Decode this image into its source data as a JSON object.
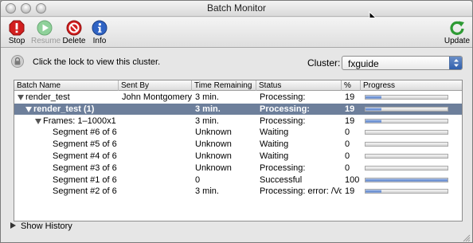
{
  "window": {
    "title": "Batch Monitor"
  },
  "toolbar": {
    "stop_label": "Stop",
    "resume_label": "Resume",
    "delete_label": "Delete",
    "info_label": "Info",
    "update_label": "Update"
  },
  "lock": {
    "text": "Click the lock to view this cluster."
  },
  "cluster": {
    "label": "Cluster:",
    "value": "fxguide"
  },
  "table": {
    "columns": [
      "Batch Name",
      "Sent By",
      "Time Remaining",
      "Status",
      "%",
      "Progress"
    ],
    "rows": [
      {
        "name": "render_test",
        "sent_by": "John  Montgomery",
        "time": "3 min.",
        "status": "Processing:",
        "percent": "19",
        "progress": 0.19,
        "level": 0,
        "expanded": true,
        "selected": false
      },
      {
        "name": "render_test (1)",
        "sent_by": "",
        "time": "3 min.",
        "status": "Processing:",
        "percent": "19",
        "progress": 0.19,
        "level": 1,
        "expanded": true,
        "selected": true
      },
      {
        "name": "Frames: 1–1000x1",
        "sent_by": "",
        "time": "3 min.",
        "status": "Processing:",
        "percent": "19",
        "progress": 0.19,
        "level": 2,
        "expanded": true,
        "selected": false
      },
      {
        "name": "Segment #6 of 6",
        "sent_by": "",
        "time": "Unknown",
        "status": "Waiting",
        "percent": "0",
        "progress": 0,
        "level": 3,
        "selected": false
      },
      {
        "name": "Segment #5 of 6",
        "sent_by": "",
        "time": "Unknown",
        "status": "Waiting",
        "percent": "0",
        "progress": 0,
        "level": 3,
        "selected": false
      },
      {
        "name": "Segment #4 of 6",
        "sent_by": "",
        "time": "Unknown",
        "status": "Waiting",
        "percent": "0",
        "progress": 0,
        "level": 3,
        "selected": false
      },
      {
        "name": "Segment #3 of 6",
        "sent_by": "",
        "time": "Unknown",
        "status": "Processing:",
        "percent": "0",
        "progress": 0,
        "level": 3,
        "selected": false
      },
      {
        "name": "Segment #1 of 6",
        "sent_by": "",
        "time": "0",
        "status": "Successful",
        "percent": "100",
        "progress": 1.0,
        "level": 3,
        "selected": false
      },
      {
        "name": "Segment #2 of 6",
        "sent_by": "",
        "time": "3 min.",
        "status": "Processing: error: /Volu",
        "percent": "19",
        "progress": 0.19,
        "level": 3,
        "selected": false
      }
    ]
  },
  "history": {
    "label": "Show History"
  },
  "colors": {
    "selection": "#6d7f9b",
    "progress": "#5f86cc",
    "stop": "#d21f1f",
    "resume": "#58b868",
    "info": "#2f63c4",
    "update": "#2e9a34"
  }
}
